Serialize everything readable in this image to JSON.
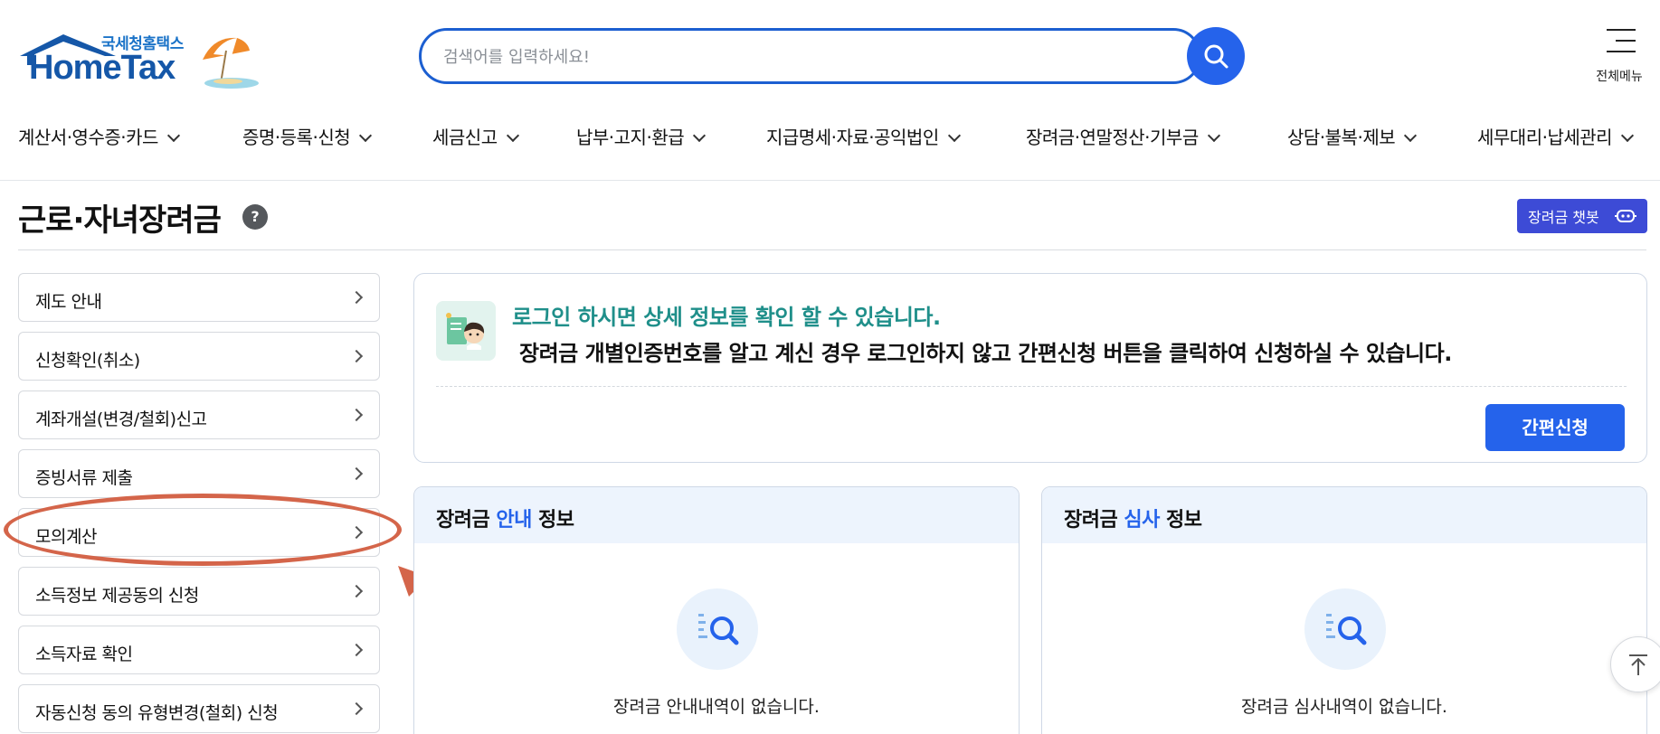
{
  "header": {
    "logo_small": "국세청홈택스",
    "logo_big": "HomeTax",
    "search_placeholder": "검색어를 입력하세요!",
    "all_menu_label": "전체메뉴"
  },
  "gnb": [
    {
      "label": "계산서·영수증·카드"
    },
    {
      "label": "증명·등록·신청"
    },
    {
      "label": "세금신고"
    },
    {
      "label": "납부·고지·환급"
    },
    {
      "label": "지급명세·자료·공익법인"
    },
    {
      "label": "장려금·연말정산·기부금"
    },
    {
      "label": "상담·불복·제보"
    },
    {
      "label": "세무대리·납세관리"
    }
  ],
  "page": {
    "title": "근로·자녀장려금",
    "help": "?",
    "chatbot_label": "장려금 챗봇"
  },
  "sidebar": [
    {
      "label": "제도 안내"
    },
    {
      "label": "신청확인(취소)"
    },
    {
      "label": "계좌개설(변경/철회)신고"
    },
    {
      "label": "증빙서류 제출"
    },
    {
      "label": "모의계산"
    },
    {
      "label": "소득정보 제공동의 신청"
    },
    {
      "label": "소득자료 확인"
    },
    {
      "label": "자동신청 동의 유형변경(철회) 신청"
    }
  ],
  "notice": {
    "line1": "로그인 하시면 상세 정보를 확인 할 수 있습니다.",
    "line2": "장려금 개별인증번호를 알고 계신 경우 로그인하지 않고 간편신청 버튼을 클릭하여 신청하실 수 있습니다.",
    "button": "간편신청"
  },
  "cards": [
    {
      "title_pre": "장려금 ",
      "title_hl": "안내",
      "title_post": " 정보",
      "empty": "장려금 안내내역이 없습니다."
    },
    {
      "title_pre": "장려금 ",
      "title_hl": "심사",
      "title_post": " 정보",
      "empty": "장려금 심사내역이 없습니다."
    }
  ],
  "colors": {
    "primary": "#2563eb",
    "logo_blue": "#1557a8",
    "notice_teal": "#1f8f8a",
    "chatbot": "#3d4bd6",
    "annotation": "#d4654a"
  }
}
